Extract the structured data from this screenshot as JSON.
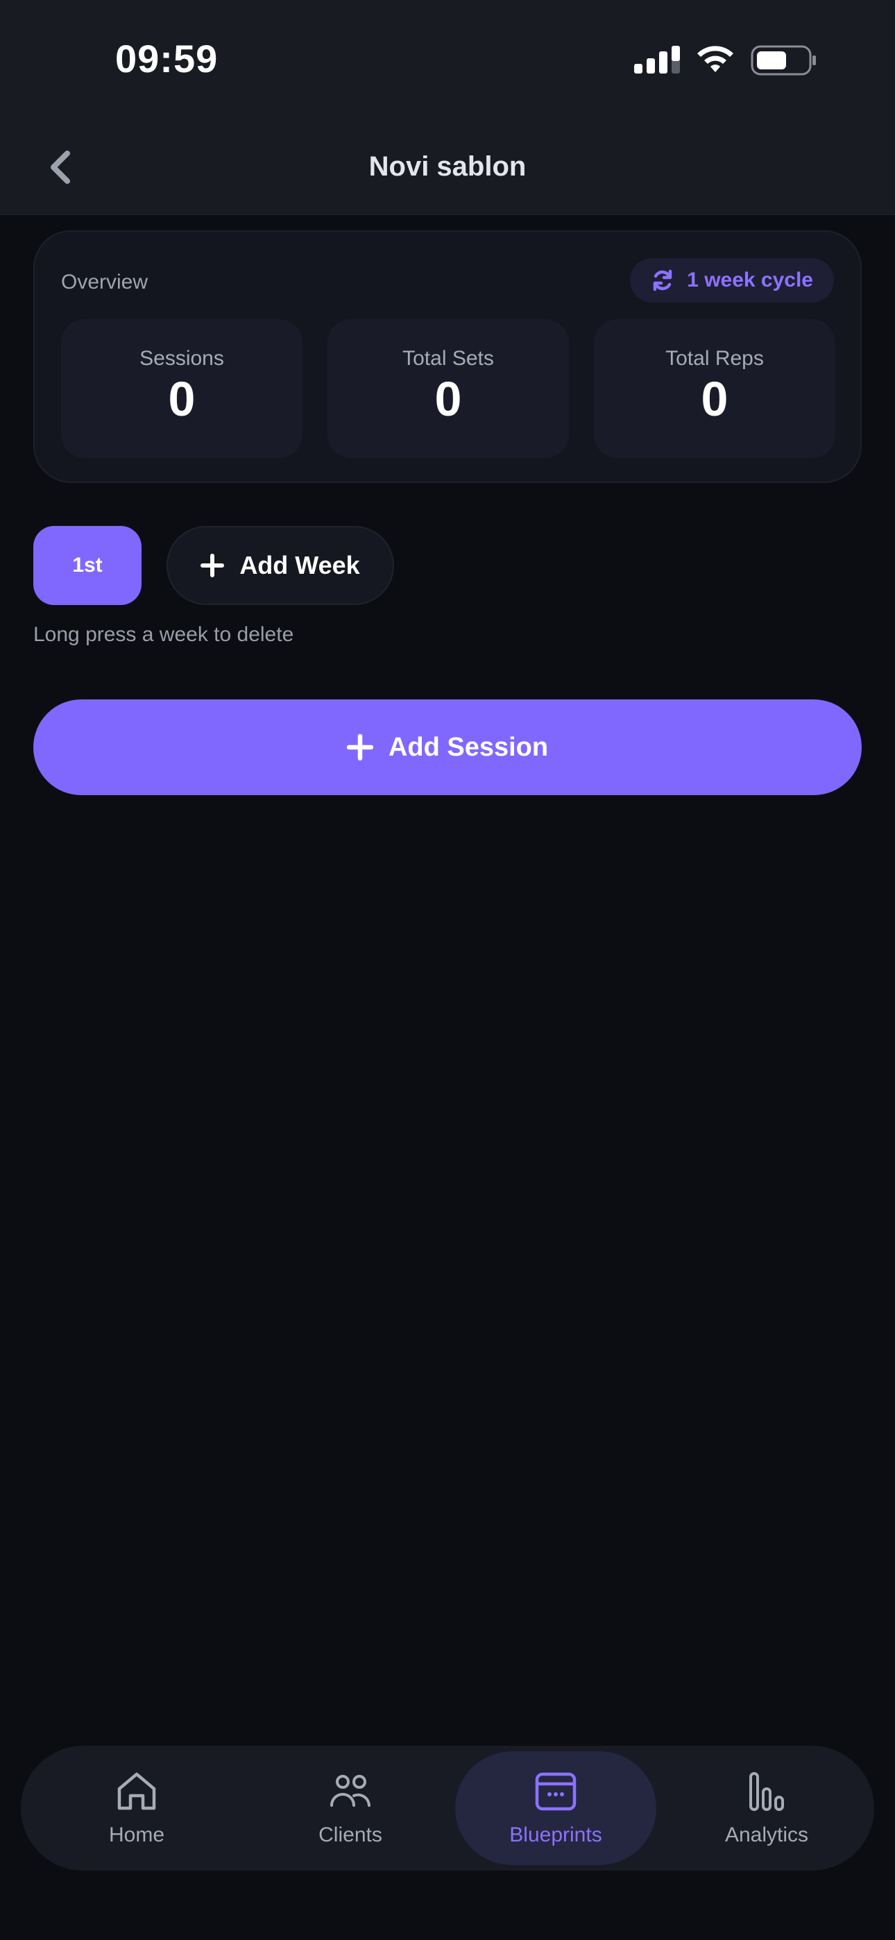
{
  "status_bar": {
    "time": "09:59"
  },
  "header": {
    "title": "Novi sablon",
    "back_icon": "chevron-left-icon"
  },
  "overview": {
    "label": "Overview",
    "cycle_badge": {
      "icon": "refresh-icon",
      "label": "1 week cycle"
    },
    "stats": [
      {
        "label": "Sessions",
        "value": "0"
      },
      {
        "label": "Total Sets",
        "value": "0"
      },
      {
        "label": "Total Reps",
        "value": "0"
      }
    ]
  },
  "weeks": {
    "items": [
      {
        "label": "1st",
        "selected": true
      }
    ],
    "add_week_label": "Add Week",
    "hint": "Long press a week to delete"
  },
  "add_session": {
    "label": "Add Session"
  },
  "bottom_nav": {
    "items": [
      {
        "label": "Home",
        "icon": "home-icon",
        "active": false
      },
      {
        "label": "Clients",
        "icon": "users-icon",
        "active": false
      },
      {
        "label": "Blueprints",
        "icon": "blueprint-icon",
        "active": true
      },
      {
        "label": "Analytics",
        "icon": "bar-chart-icon",
        "active": false
      }
    ]
  },
  "colors": {
    "accent": "#8068FF",
    "accent_text": "#8B72FF",
    "background": "#0C0D12",
    "header_bg": "#181B22",
    "card_bg": "#13161E"
  }
}
